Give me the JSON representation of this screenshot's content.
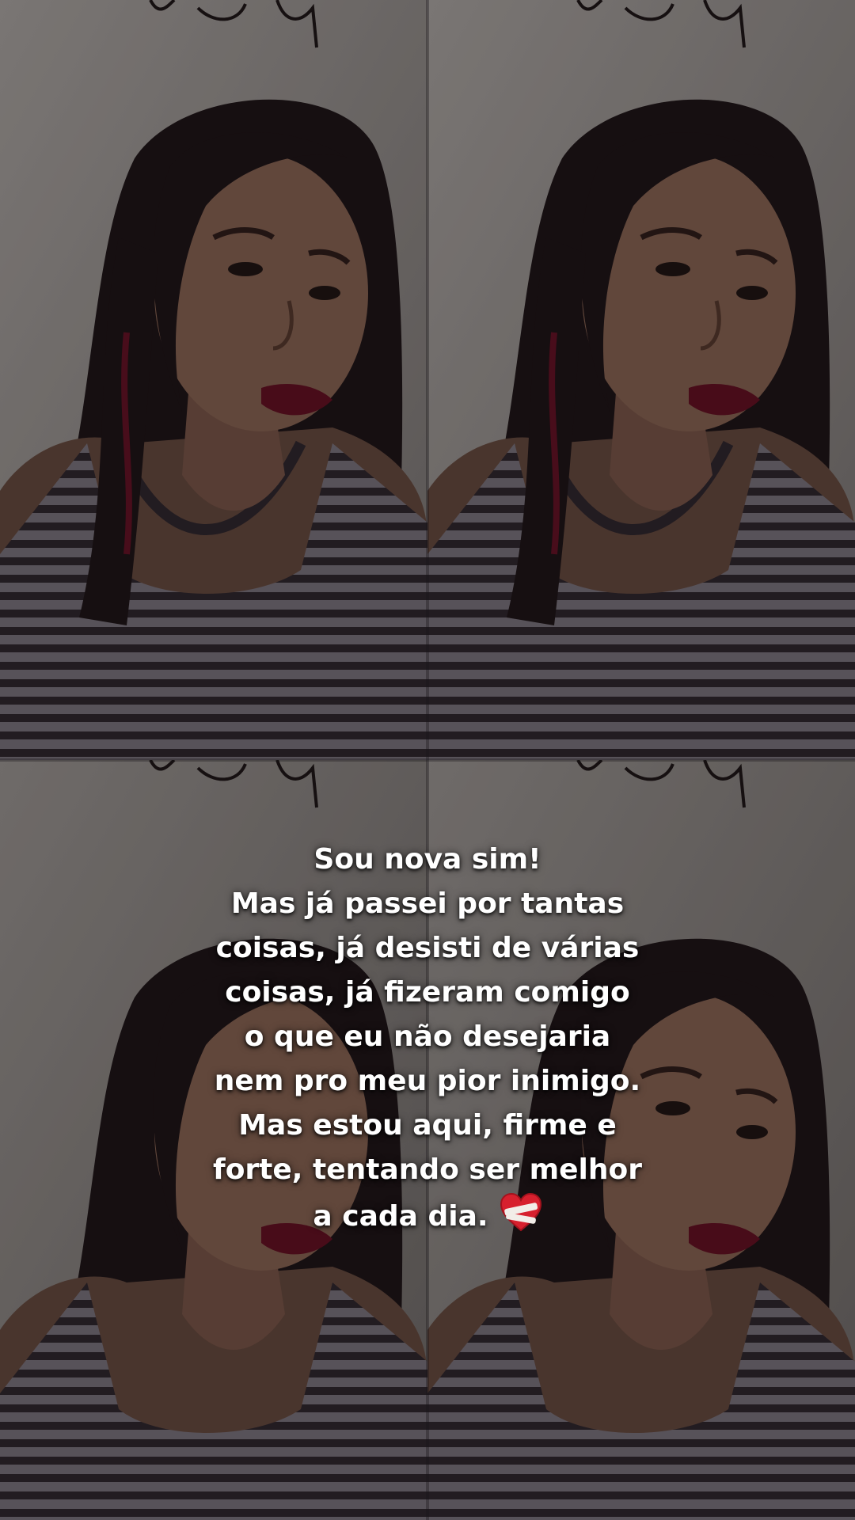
{
  "story": {
    "caption_lines": [
      "Sou nova sim!",
      "Mas já passei por tantas",
      "coisas, já desisti de várias",
      "coisas, já fizeram comigo",
      "o que eu não desejaria",
      "nem pro meu pior inimigo.",
      "Mas estou aqui, firme e",
      "forte, tentando ser melhor",
      "a cada dia."
    ],
    "caption_emoji": "mending-heart-icon",
    "caption_color": "#ffffff"
  },
  "collage": {
    "tiles": [
      {
        "name": "photo-tile-top-left",
        "alt": "selfie photo"
      },
      {
        "name": "photo-tile-top-right",
        "alt": "selfie photo"
      },
      {
        "name": "photo-tile-bottom-left",
        "alt": "selfie photo"
      },
      {
        "name": "photo-tile-bottom-right",
        "alt": "selfie photo"
      }
    ],
    "colors": {
      "wall": "#8e8a86",
      "skin": "#7a5a4a",
      "hair": "#1a1214",
      "lips": "#5a0f1e",
      "top_stripe_dark": "#2a2328",
      "top_stripe_light": "#6e6870"
    }
  }
}
